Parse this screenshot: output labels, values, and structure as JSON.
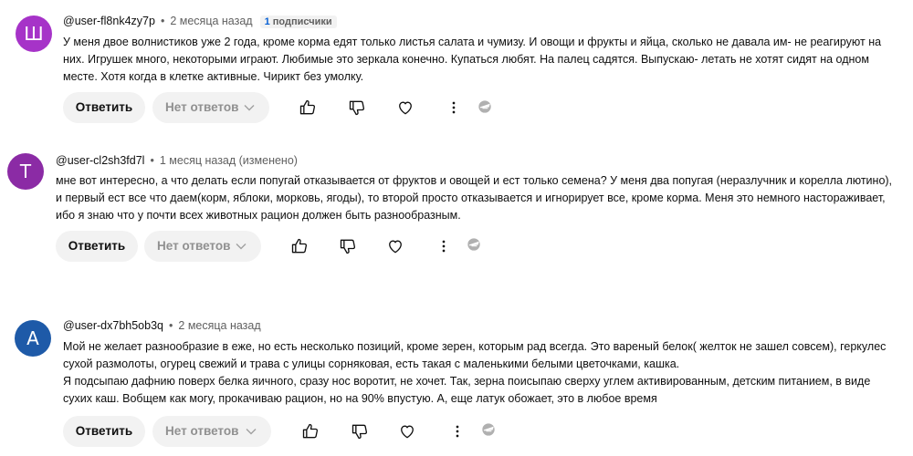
{
  "comments": [
    {
      "avatar_letter": "Ш",
      "avatar_color": "#a633c8",
      "author": "@user-fl8nk4zy7p",
      "time": "2 месяца назад",
      "subscribers_count": "1",
      "subscribers_label": "подписчики",
      "lines": [
        "У меня двое волнистиков уже 2 года, кроме корма едят только листья салата и чумизу. И овощи и фрукты и яйца, сколько не давала им- не реагируют на",
        "них. Игрушек много, некоторыми играют. Любимые это зеркала конечно. Купаться любят. На палец садятся. Выпускаю- летать не хотят сидят на одном",
        "месте. Хотя когда в клетке активные. Чирикт без умолку."
      ],
      "reply_label": "Ответить",
      "no_replies_label": "Нет ответов"
    },
    {
      "avatar_letter": "T",
      "avatar_color": "#8b2ba5",
      "author": "@user-cl2sh3fd7l",
      "time": "1 месяц назад (изменено)",
      "lines": [
        "мне вот интересно, а что делать если попугай отказывается от фруктов и овощей и ест только семена? У меня два попугая (неразлучник и корелла лютино),",
        "и первый ест все что даем(корм, яблоки, морковь, ягоды), то второй просто отказывается и игнорирует все, кроме корма. Меня это немного настораживает,",
        "ибо я знаю что у почти всех животных рацион должен быть разнообразным."
      ],
      "reply_label": "Ответить",
      "no_replies_label": "Нет ответов"
    },
    {
      "avatar_letter": "A",
      "avatar_color": "#1e5aa8",
      "author": "@user-dx7bh5ob3q",
      "time": "2 месяца назад",
      "lines": [
        "Мой не желает разнообразие в еже, но есть несколько позиций, кроме зерен, которым рад всегда. Это вареный белок( желток не зашел совсем), геркулес",
        "сухой размолоты, огурец свежий и трава с улицы сорняковая, есть такая с маленькими белыми цветочками, кашка.",
        "Я подсыпаю дафнию поверх белка яичного, сразу нос воротит, не хочет. Так, зерна поисыпаю сверху углем активированным, детским питанием, в виде",
        "сухих каш. Вобщем как могу, прокачиваю рацион, но на 90% впустую. А, еще латук обожает, это в любое время"
      ],
      "reply_label": "Ответить",
      "no_replies_label": "Нет ответов"
    }
  ]
}
